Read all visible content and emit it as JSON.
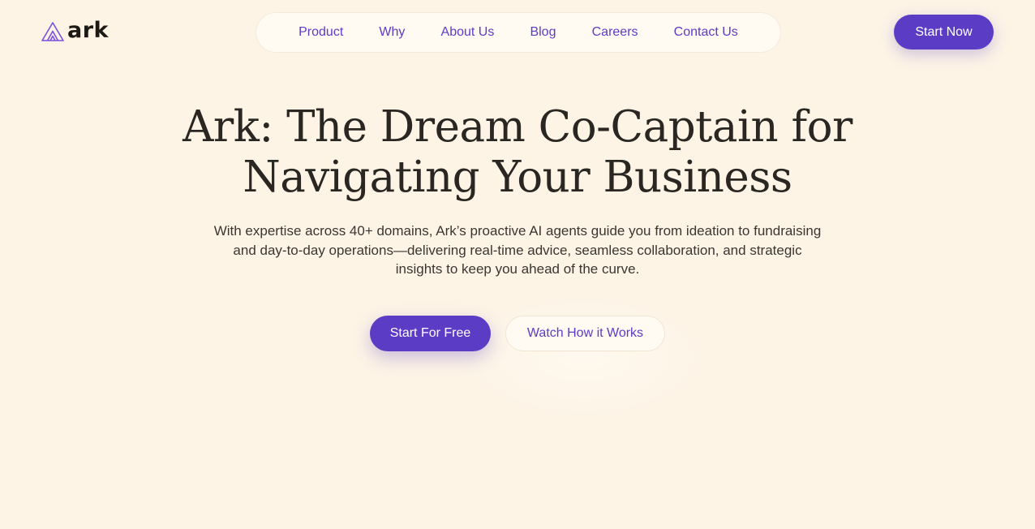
{
  "brand": {
    "name": "ark",
    "logo_icon": "ark-triangle-logo-icon",
    "accent_color": "#5b3cc4"
  },
  "nav": {
    "items": [
      {
        "label": "Product"
      },
      {
        "label": "Why"
      },
      {
        "label": "About Us"
      },
      {
        "label": "Blog"
      },
      {
        "label": "Careers"
      },
      {
        "label": "Contact Us"
      }
    ]
  },
  "header_cta": {
    "label": "Start Now"
  },
  "hero": {
    "title_line1": "Ark: The Dream Co-Captain for",
    "title_line2": "Navigating Your Business",
    "subtitle": "With expertise across 40+ domains, Ark’s proactive AI agents guide you from ideation to fundraising and day-to-day operations—delivering real-time advice, seamless collaboration, and strategic insights to keep you ahead of the curve.",
    "primary_cta": "Start For Free",
    "secondary_cta": "Watch How it Works"
  },
  "colors": {
    "background": "#fdf4e6",
    "text": "#2a2622"
  }
}
